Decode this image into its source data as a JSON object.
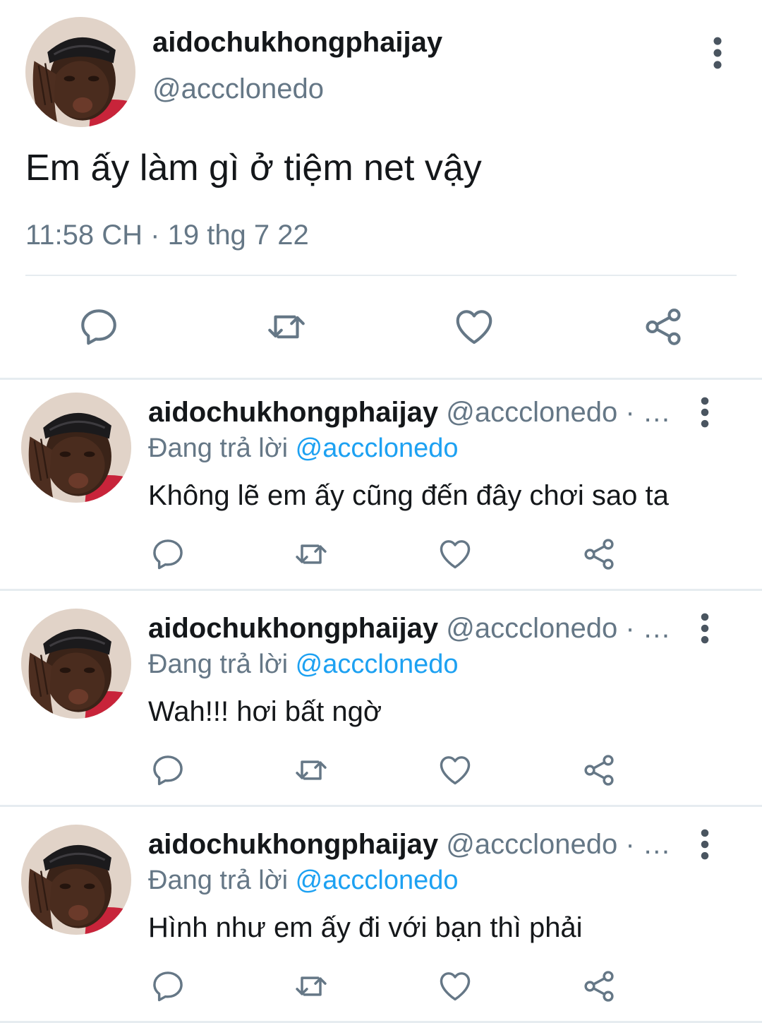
{
  "main_tweet": {
    "author_name": "aidochukhongphaijay",
    "author_handle": "@accclonedo",
    "text": "Em ấy làm gì ở tiệm net vậy",
    "time": "11:58 CH",
    "dot": "·",
    "date": "19 thg 7 22"
  },
  "replies": [
    {
      "author_name": "aidochukhongphaijay",
      "author_handle": "@accclonedo · …",
      "replying_prefix": "Đang trả lời",
      "replying_to": "@accclonedo",
      "text": "Không lẽ em ấy cũng đến đây chơi sao ta"
    },
    {
      "author_name": "aidochukhongphaijay",
      "author_handle": "@accclonedo · …",
      "replying_prefix": "Đang trả lời",
      "replying_to": "@accclonedo",
      "text": "Wah!!! hơi bất ngờ"
    },
    {
      "author_name": "aidochukhongphaijay",
      "author_handle": "@accclonedo · …",
      "replying_prefix": "Đang trả lời",
      "replying_to": "@accclonedo",
      "text": "Hình như em ấy đi với bạn thì phải"
    }
  ],
  "icons": {
    "reply": "reply-icon",
    "retweet": "retweet-icon",
    "like": "heart-icon",
    "share": "share-icon",
    "more": "more-vertical-icon"
  },
  "colors": {
    "text": "#14171a",
    "secondary": "#657786",
    "mention": "#1da1f2",
    "divider": "#e6ecf0"
  }
}
